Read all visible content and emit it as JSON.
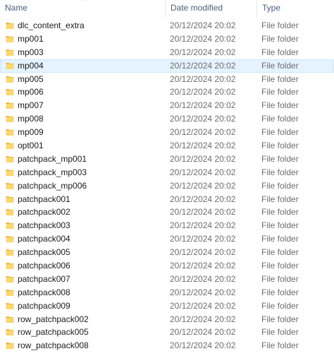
{
  "columns": {
    "name": "Name",
    "date": "Date modified",
    "type": "Type"
  },
  "colors": {
    "selected_row": "#e5f3ff",
    "folder_yellow": "#f8d775"
  },
  "files": [
    {
      "name": "dlc_content_extra",
      "date": "20/12/2024 20:02",
      "type": "File folder",
      "icon": "folder-icon"
    },
    {
      "name": "mp001",
      "date": "20/12/2024 20:02",
      "type": "File folder",
      "icon": "folder-icon"
    },
    {
      "name": "mp003",
      "date": "20/12/2024 20:02",
      "type": "File folder",
      "icon": "folder-icon"
    },
    {
      "name": "mp004",
      "date": "20/12/2024 20:02",
      "type": "File folder",
      "icon": "folder-icon",
      "selected": true
    },
    {
      "name": "mp005",
      "date": "20/12/2024 20:02",
      "type": "File folder",
      "icon": "folder-icon"
    },
    {
      "name": "mp006",
      "date": "20/12/2024 20:02",
      "type": "File folder",
      "icon": "folder-icon"
    },
    {
      "name": "mp007",
      "date": "20/12/2024 20:02",
      "type": "File folder",
      "icon": "folder-icon"
    },
    {
      "name": "mp008",
      "date": "20/12/2024 20:02",
      "type": "File folder",
      "icon": "folder-icon"
    },
    {
      "name": "mp009",
      "date": "20/12/2024 20:02",
      "type": "File folder",
      "icon": "folder-icon"
    },
    {
      "name": "opt001",
      "date": "20/12/2024 20:02",
      "type": "File folder",
      "icon": "folder-icon"
    },
    {
      "name": "patchpack_mp001",
      "date": "20/12/2024 20:02",
      "type": "File folder",
      "icon": "folder-icon"
    },
    {
      "name": "patchpack_mp003",
      "date": "20/12/2024 20:02",
      "type": "File folder",
      "icon": "folder-icon"
    },
    {
      "name": "patchpack_mp006",
      "date": "20/12/2024 20:02",
      "type": "File folder",
      "icon": "folder-icon"
    },
    {
      "name": "patchpack001",
      "date": "20/12/2024 20:02",
      "type": "File folder",
      "icon": "folder-icon"
    },
    {
      "name": "patchpack002",
      "date": "20/12/2024 20:02",
      "type": "File folder",
      "icon": "folder-icon"
    },
    {
      "name": "patchpack003",
      "date": "20/12/2024 20:02",
      "type": "File folder",
      "icon": "folder-icon"
    },
    {
      "name": "patchpack004",
      "date": "20/12/2024 20:02",
      "type": "File folder",
      "icon": "folder-icon"
    },
    {
      "name": "patchpack005",
      "date": "20/12/2024 20:02",
      "type": "File folder",
      "icon": "folder-icon"
    },
    {
      "name": "patchpack006",
      "date": "20/12/2024 20:02",
      "type": "File folder",
      "icon": "folder-icon"
    },
    {
      "name": "patchpack007",
      "date": "20/12/2024 20:02",
      "type": "File folder",
      "icon": "folder-icon"
    },
    {
      "name": "patchpack008",
      "date": "20/12/2024 20:02",
      "type": "File folder",
      "icon": "folder-icon"
    },
    {
      "name": "patchpack009",
      "date": "20/12/2024 20:02",
      "type": "File folder",
      "icon": "folder-icon"
    },
    {
      "name": "row_patchpack002",
      "date": "20/12/2024 20:02",
      "type": "File folder",
      "icon": "folder-icon"
    },
    {
      "name": "row_patchpack005",
      "date": "20/12/2024 20:02",
      "type": "File folder",
      "icon": "folder-icon"
    },
    {
      "name": "row_patchpack008",
      "date": "20/12/2024 20:02",
      "type": "File folder",
      "icon": "folder-icon"
    }
  ]
}
